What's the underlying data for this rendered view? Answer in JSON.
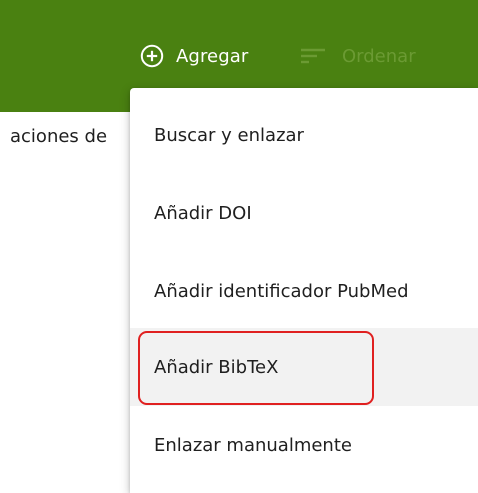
{
  "colors": {
    "bar_bg": "#4a8111",
    "muted": "#6b9a33",
    "hover_bg": "#f2f2f2",
    "highlight": "#e02020"
  },
  "toolbar": {
    "add_icon": "plus-circle-icon",
    "add_label": "Agregar",
    "sort_icon": "sort-lines-icon",
    "sort_label": "Ordenar"
  },
  "background": {
    "partial_text": "aciones de"
  },
  "menu": {
    "items": [
      {
        "label": "Buscar y enlazar"
      },
      {
        "label": "Añadir DOI"
      },
      {
        "label": "Añadir identificador PubMed"
      },
      {
        "label": "Añadir BibTeX",
        "state": "hover"
      },
      {
        "label": "Enlazar manualmente"
      }
    ]
  }
}
